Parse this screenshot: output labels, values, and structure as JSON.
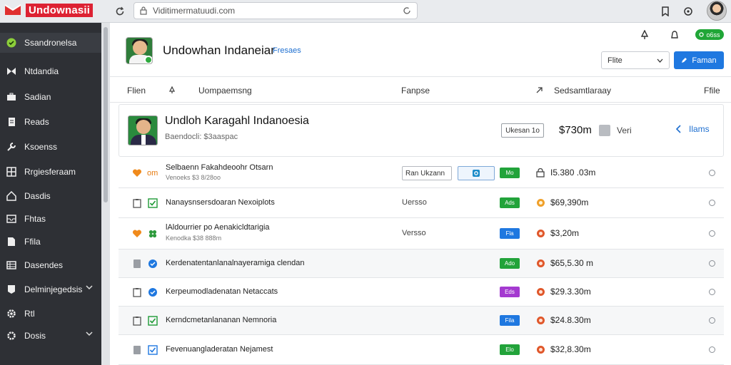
{
  "topbar": {
    "brand": "Undownasii",
    "address": "Viditimermatuudi.com"
  },
  "sidebar": {
    "items": [
      {
        "label": "Ssandronelsa",
        "icon": "circle-check-icon"
      },
      {
        "label": "Ntdandia",
        "icon": "bow-tie-icon"
      },
      {
        "label": "Sadian",
        "icon": "briefcase-icon"
      },
      {
        "label": "Reads",
        "icon": "document-icon"
      },
      {
        "label": "Ksoenss",
        "icon": "wrench-icon"
      },
      {
        "label": "Rrgiesferaam",
        "icon": "grid-icon"
      },
      {
        "label": "Dasdis",
        "icon": "home-icon"
      },
      {
        "label": "Fhtas",
        "icon": "inbox-icon"
      },
      {
        "label": "Ffila",
        "icon": "file-icon"
      },
      {
        "label": "Dasendes",
        "icon": "table-icon"
      },
      {
        "label": "Delminjegedsis",
        "icon": "tag-icon"
      },
      {
        "label": "Rtl",
        "icon": "gear-icon"
      },
      {
        "label": "Dosis",
        "icon": "settings-icon"
      }
    ]
  },
  "header": {
    "title": "Undowhan Indaneiar",
    "link": "Fresaes",
    "status": "o6ss",
    "filter_value": "Flite",
    "primary_button": "Faman"
  },
  "columns": {
    "c1": "Flien",
    "c2": "Uompaemsng",
    "c3": "Fanpse",
    "c4": "Sedsamtlaraay",
    "c5": "Ffile"
  },
  "featured": {
    "title": "Undloh Karagahl Indanoesia",
    "subtitle": "Baendocli: $3aaspac",
    "tag": "Ukesan 1o",
    "price": "$730m",
    "verify": "Veri",
    "back": "Ilams"
  },
  "rows": [
    {
      "name": "Selbaenn Fakahdeoohr Otsarn",
      "sub": "Venoeks $3 8/28oo",
      "mid": "",
      "input": "Ran Ukzann",
      "badge": "Mo",
      "badge_color": "#22a33a",
      "amount": "I5.380 .03m",
      "lead1": "heart-icon",
      "lead2": "om"
    },
    {
      "name": "Nanaysnsersdoaran Nexoiplots",
      "sub": "",
      "mid": "Uersso",
      "input": "",
      "badge": "Ads",
      "badge_color": "#22a33a",
      "amount": "$69,390m",
      "lead1": "clipboard-icon",
      "lead2": "check-box-icon"
    },
    {
      "name": "lAldourrier po Aenakicldtarigia",
      "sub": "Kenodka $38 888m",
      "mid": "Versso",
      "input": "",
      "badge": "Fla",
      "badge_color": "#1f78e0",
      "amount": "$3,20m",
      "lead1": "heart-icon",
      "lead2": "clover-icon"
    },
    {
      "name": "Kerdenatentanlanalnayeramiga clendan",
      "sub": "",
      "mid": "",
      "input": "",
      "badge": "Ado",
      "badge_color": "#22a33a",
      "amount": "$65,5.30 m",
      "lead1": "square-icon",
      "lead2": "chat-icon"
    },
    {
      "name": "Kerpeumodladenatan Netaccats",
      "sub": "",
      "mid": "",
      "input": "",
      "badge": "Eds",
      "badge_color": "#a43ad0",
      "amount": "$29.3.30m",
      "lead1": "clipboard-icon",
      "lead2": "chat-icon"
    },
    {
      "name": "Kerndcmetanlananan Nemnoria",
      "sub": "",
      "mid": "",
      "input": "",
      "badge": "Fila",
      "badge_color": "#1f78e0",
      "amount": "$24.8.30m",
      "lead1": "clipboard-icon",
      "lead2": "check-box-icon"
    },
    {
      "name": "Fevenuangladeratan Nejamest",
      "sub": "",
      "mid": "",
      "input": "",
      "badge": "Elo",
      "badge_color": "#22a33a",
      "amount": "$32,8.30m",
      "lead1": "square-icon",
      "lead2": "check-icon"
    }
  ]
}
